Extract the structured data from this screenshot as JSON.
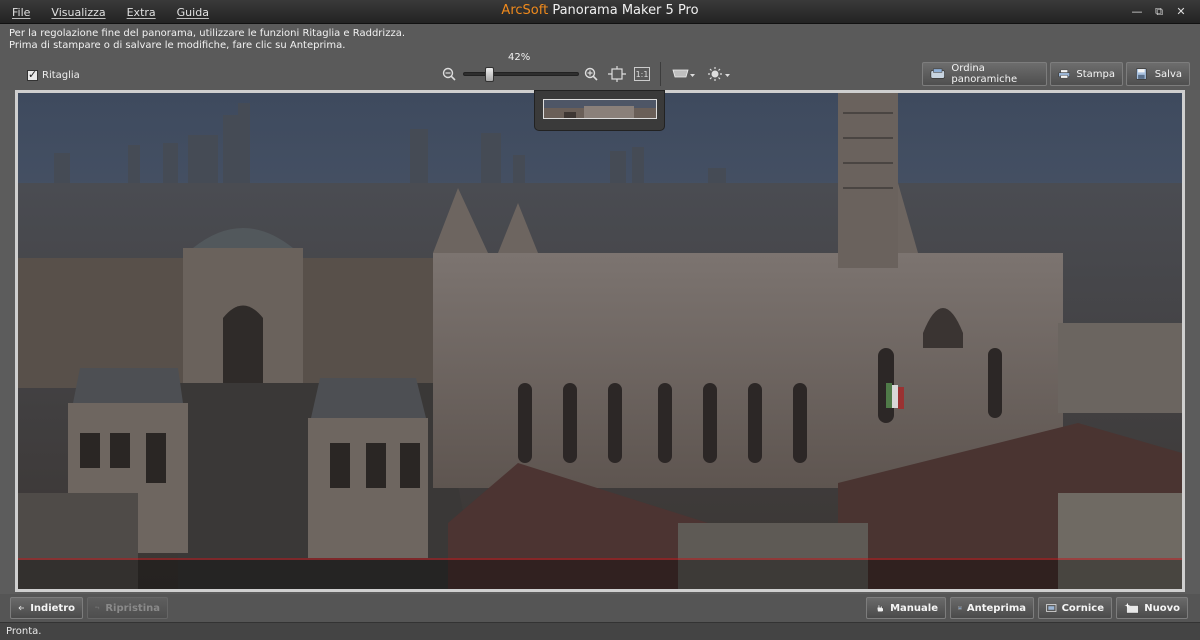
{
  "menu": {
    "items": [
      "File",
      "Visualizza",
      "Extra",
      "Guida"
    ]
  },
  "app": {
    "brand": "ArcSoft",
    "title": "Panorama Maker 5 Pro"
  },
  "window": {
    "minimize": "—",
    "maximize": "⧉",
    "close": "✕"
  },
  "toolbar": {
    "hint_line1": "Per la regolazione fine del panorama, utilizzare le funzioni Ritaglia e Raddrizza.",
    "hint_line2": "Prima di stampare o di salvare le modifiche, fare clic su Anteprima.",
    "crop_label": "Ritaglia",
    "crop_checked": true,
    "zoom_percent": "42%",
    "zoom_level": 0.2,
    "one_to_one": "1:1",
    "order_button": "Ordina panoramiche",
    "print_button": "Stampa",
    "save_button": "Salva"
  },
  "bottom": {
    "back": "Indietro",
    "restore": "Ripristina",
    "manual": "Manuale",
    "preview": "Anteprima",
    "frame": "Cornice",
    "new": "Nuovo"
  },
  "status": {
    "text": "Pronta."
  },
  "colors": {
    "accent": "#f08a1c",
    "crop_line": "#c0181c"
  }
}
